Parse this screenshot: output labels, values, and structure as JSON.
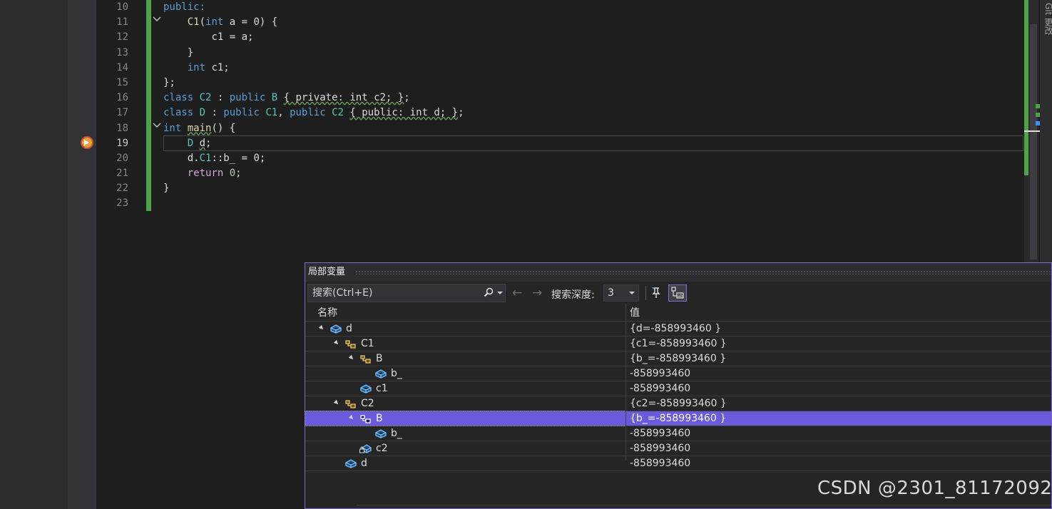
{
  "editor": {
    "line_numbers": [
      "10",
      "11",
      "12",
      "13",
      "14",
      "15",
      "16",
      "17",
      "18",
      "19",
      "20",
      "21",
      "22",
      "23"
    ],
    "current_line": "19",
    "code": {
      "l10_public": "public:",
      "l11_ctor": "C1",
      "l11_open": "(",
      "l11_int": "int",
      "l11_rest": " a = 0) {",
      "l12": "c1 = a;",
      "l13": "}",
      "l14_int": "int",
      "l14_rest": " c1;",
      "l15": "};",
      "l16_class": "class",
      "l16_name": "C2",
      "l16_mid": " : ",
      "l16_public": "public",
      "l16_base": "B",
      "l16_body": "{ private: int c2; }",
      "l16_end": ";",
      "l17_class": "class",
      "l17_name": "D",
      "l17_mid": " : ",
      "l17_public1": "public",
      "l17_base1": "C1",
      "l17_comma": ", ",
      "l17_public2": "public",
      "l17_base2": "C2",
      "l17_body": "{ public: int d; }",
      "l17_end": ";",
      "l18_int": "int",
      "l18_main": "main",
      "l18_rest": "() {",
      "l19_type": "D",
      "l19_var": "d",
      "l19_end": ";",
      "l20_pre": "d.",
      "l20_c1": "C1",
      "l20_rest": "::b_ = 0;",
      "l21_return": "return",
      "l21_zero": "0",
      "l21_end": ";",
      "l22": "}"
    }
  },
  "side_panel": {
    "tab_label": "Git 更改"
  },
  "locals": {
    "title": "局部变量",
    "search_placeholder": "搜索(Ctrl+E)",
    "depth_label": "搜索深度:",
    "depth_value": "3",
    "col_name": "名称",
    "col_value": "值",
    "rows": [
      {
        "name": "d",
        "value": "{d=-858993460 }"
      },
      {
        "name": "C1",
        "value": "{c1=-858993460 }"
      },
      {
        "name": "B",
        "value": "{b_=-858993460 }"
      },
      {
        "name": "b_",
        "value": "-858993460"
      },
      {
        "name": "c1",
        "value": "-858993460"
      },
      {
        "name": "C2",
        "value": "{c2=-858993460 }"
      },
      {
        "name": "B",
        "value": "{b_=-858993460 }"
      },
      {
        "name": "b_",
        "value": "-858993460"
      },
      {
        "name": "c2",
        "value": "-858993460"
      },
      {
        "name": "d",
        "value": "-858993460"
      }
    ]
  },
  "watermark": "CSDN @2301_81172092"
}
